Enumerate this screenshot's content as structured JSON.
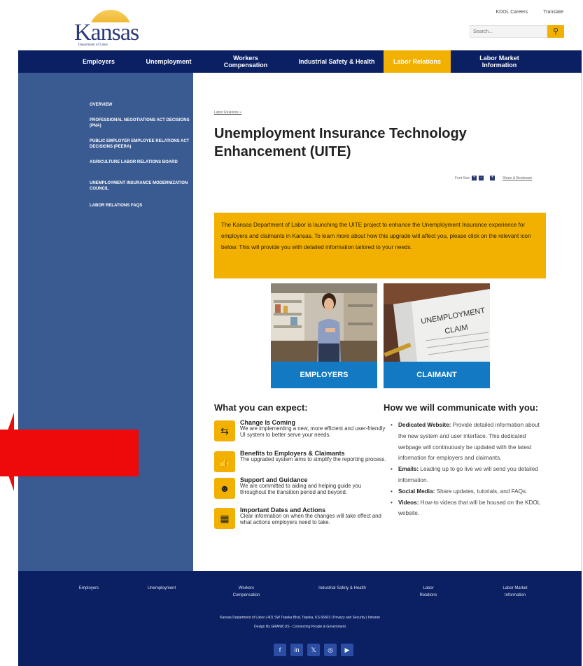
{
  "header": {
    "logo_text": "Kansas",
    "logo_sub": "Department of Labor",
    "top_links": [
      "KDOL Careers",
      "Translate"
    ],
    "search_placeholder": "Search..."
  },
  "nav": {
    "items": [
      {
        "label": "Employers"
      },
      {
        "label": "Unemployment"
      },
      {
        "label": "Workers Compensation"
      },
      {
        "label": "Industrial Safety & Health"
      },
      {
        "label": "Labor Relations"
      },
      {
        "label": "Labor Market Information"
      }
    ]
  },
  "sidebar": {
    "items": [
      {
        "label": "Overview"
      },
      {
        "label": "Professional Negotiations Act Decisions (PNA)"
      },
      {
        "label": "Public Employer Employee Relations Act Decisions (PEERA)"
      },
      {
        "label": "Agriculture Labor Relations Board"
      },
      {
        "label": "Unemployment Insurance Modernization Council"
      },
      {
        "label": "Labor Relations FAQs"
      }
    ]
  },
  "main": {
    "breadcrumb": "Labor Relations »",
    "title": "Unemployment Insurance Technology Enhancement (UITE)",
    "font_size_label": "Font Size",
    "share_label": "Share & Bookmark",
    "notice": "The Kansas Department of Labor is launching the UITE project to enhance the Unemployment Insurance experience for employers and claimants in Kansas. To learn more about how this upgrade will affect you, please click on the relevant icon below. This will provide you with detailed information tailored to your needs.",
    "cards": [
      {
        "label": "EMPLOYERS"
      },
      {
        "label": "CLAIMANT",
        "image_text_1": "UNEMPLOYMENT",
        "image_text_2": "CLAIM"
      }
    ],
    "expect_title": "What you can expect:",
    "expect_items": [
      {
        "title": "Change Is Coming",
        "desc": "We are implementing a new, more efficient and user-friendly UI system to better serve your needs.",
        "icon": "arrows-icon"
      },
      {
        "title": "Benefits to Employers & Claimants",
        "desc": "The upgraded system aims to simplify the reporting process.",
        "icon": "thumbs-up-icon"
      },
      {
        "title": "Support and Guidance",
        "desc": "We are committed to aiding and helping guide you throughout the transition period and beyond.",
        "icon": "support-agent-icon"
      },
      {
        "title": "Important Dates and Actions",
        "desc": "Clear information on when the changes will take effect and what actions employers need to take.",
        "icon": "calendar-icon"
      }
    ],
    "communicate_title": "How we will communicate with you:",
    "communicate_items": [
      {
        "title": "Dedicated Website:",
        "text": "Provide detailed information about the new system and user interface. This dedicated webpage will continuously be updated with the latest information for employers and claimants."
      },
      {
        "title": "Emails:",
        "text": "Leading up to go live we will send you detailed information."
      },
      {
        "title": "Social Media:",
        "text": "Share updates, tutorials, and FAQs."
      },
      {
        "title": "Videos:",
        "text": "How-to videos that will be housed on the KDOL website."
      }
    ]
  },
  "footer": {
    "nav": [
      {
        "label": "Employers"
      },
      {
        "label": "Unemployment"
      },
      {
        "label": "Workers Compensation"
      },
      {
        "label": "Industrial Safety & Health"
      },
      {
        "label": "Labor Relations"
      },
      {
        "label": "Labor Market Information"
      }
    ],
    "address_line": "Kansas Department of Labor  |  401 SW Topeka Blvd, Topeka, KS 66603  |  Privacy and Security  |  Intranet",
    "design_line": "Design By GRANICUS - Connecting People & Government",
    "social": [
      "facebook-icon",
      "linkedin-icon",
      "x-icon",
      "instagram-icon",
      "youtube-icon"
    ]
  },
  "colors": {
    "navy": "#0a2063",
    "gold": "#f2b000",
    "sidebar": "#3a5a92",
    "card_blue": "#1279c2",
    "annotation_arrow": "#ee0a0a"
  }
}
